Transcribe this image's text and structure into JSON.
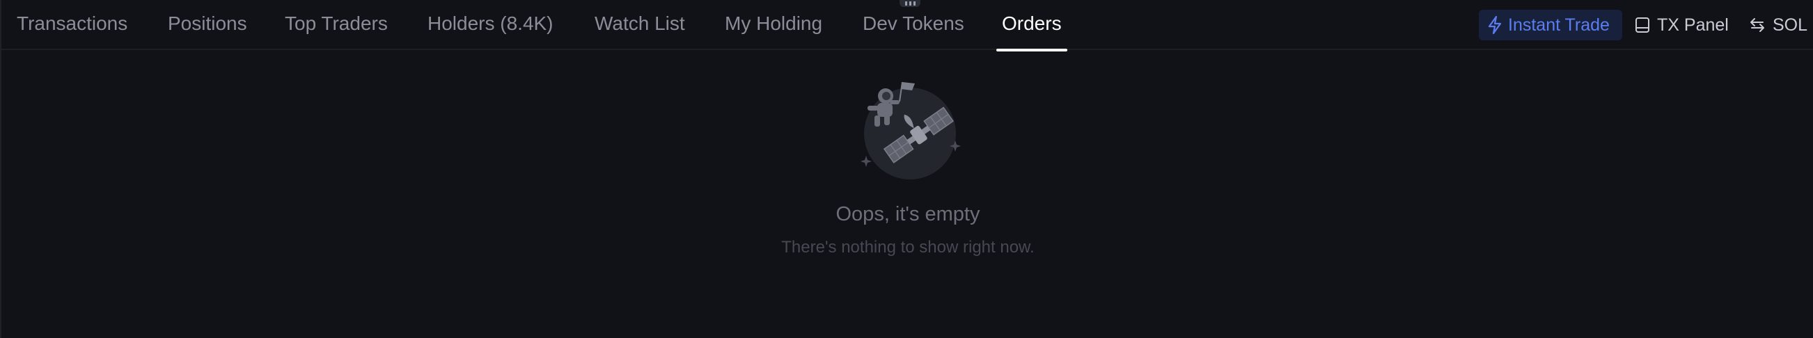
{
  "tabs": [
    {
      "label": "Transactions"
    },
    {
      "label": "Positions"
    },
    {
      "label": "Top Traders"
    },
    {
      "label": "Holders (8.4K)"
    },
    {
      "label": "Watch List"
    },
    {
      "label": "My Holding"
    },
    {
      "label": "Dev Tokens"
    },
    {
      "label": "Orders"
    }
  ],
  "active_tab": "Orders",
  "toolbar": {
    "instant_trade_label": "Instant Trade",
    "tx_panel_label": "TX Panel",
    "currency_label": "SOL"
  },
  "empty_state": {
    "title": "Oops, it's empty",
    "subtitle": "There's nothing to show right now."
  },
  "colors": {
    "background": "#111217",
    "accent": "#5b7df0",
    "accent_bg": "#18213c",
    "tab_inactive": "#8b8e99",
    "tab_active": "#ffffff"
  },
  "icons": {
    "instant_trade": "lightning-icon",
    "tx_panel": "panel-icon",
    "currency": "swap-arrows-icon",
    "illustration": "astronaut-satellite-illustration"
  }
}
